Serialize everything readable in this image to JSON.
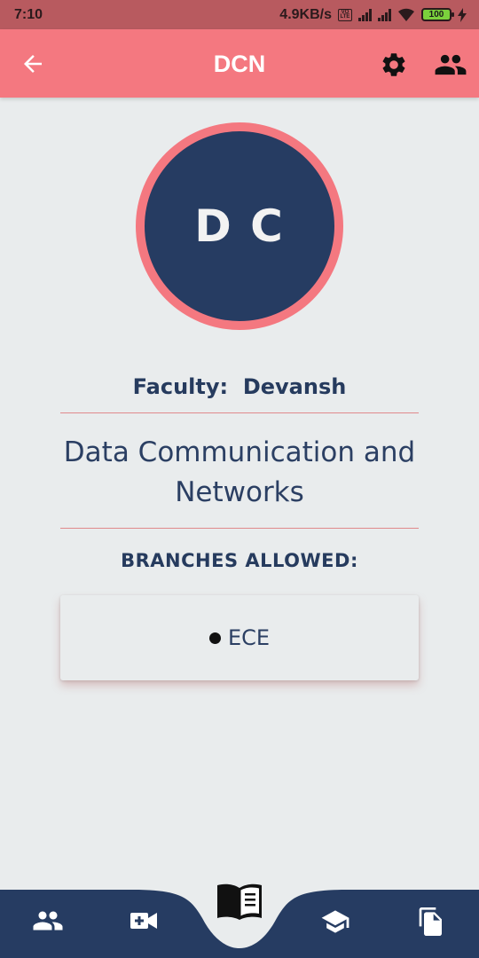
{
  "status_bar": {
    "time": "7:10",
    "network_speed": "4.9KB/s",
    "battery": "100",
    "icons": [
      "volte-icon",
      "signal-icon",
      "signal-icon",
      "wifi-icon",
      "battery-icon",
      "charging-icon"
    ]
  },
  "app_bar": {
    "title": "DCN",
    "icons": [
      "back-arrow-icon",
      "gear-icon",
      "people-icon"
    ]
  },
  "profile": {
    "initials": "D C",
    "faculty_label": "Faculty:",
    "faculty_name": "Devansh",
    "course_line1": "Data Communication and",
    "course_line2": "Networks"
  },
  "branches": {
    "heading": "BRANCHES ALLOWED:",
    "items": [
      "ECE"
    ]
  },
  "bottom_nav": {
    "items": [
      "people-icon",
      "video-add-icon",
      "book-icon",
      "graduation-cap-icon",
      "documents-icon"
    ],
    "selected": "book-icon"
  },
  "colors": {
    "accent": "#f47880",
    "navy": "#263c62",
    "background": "#e9eced",
    "status_bar": "#b85a5f"
  }
}
